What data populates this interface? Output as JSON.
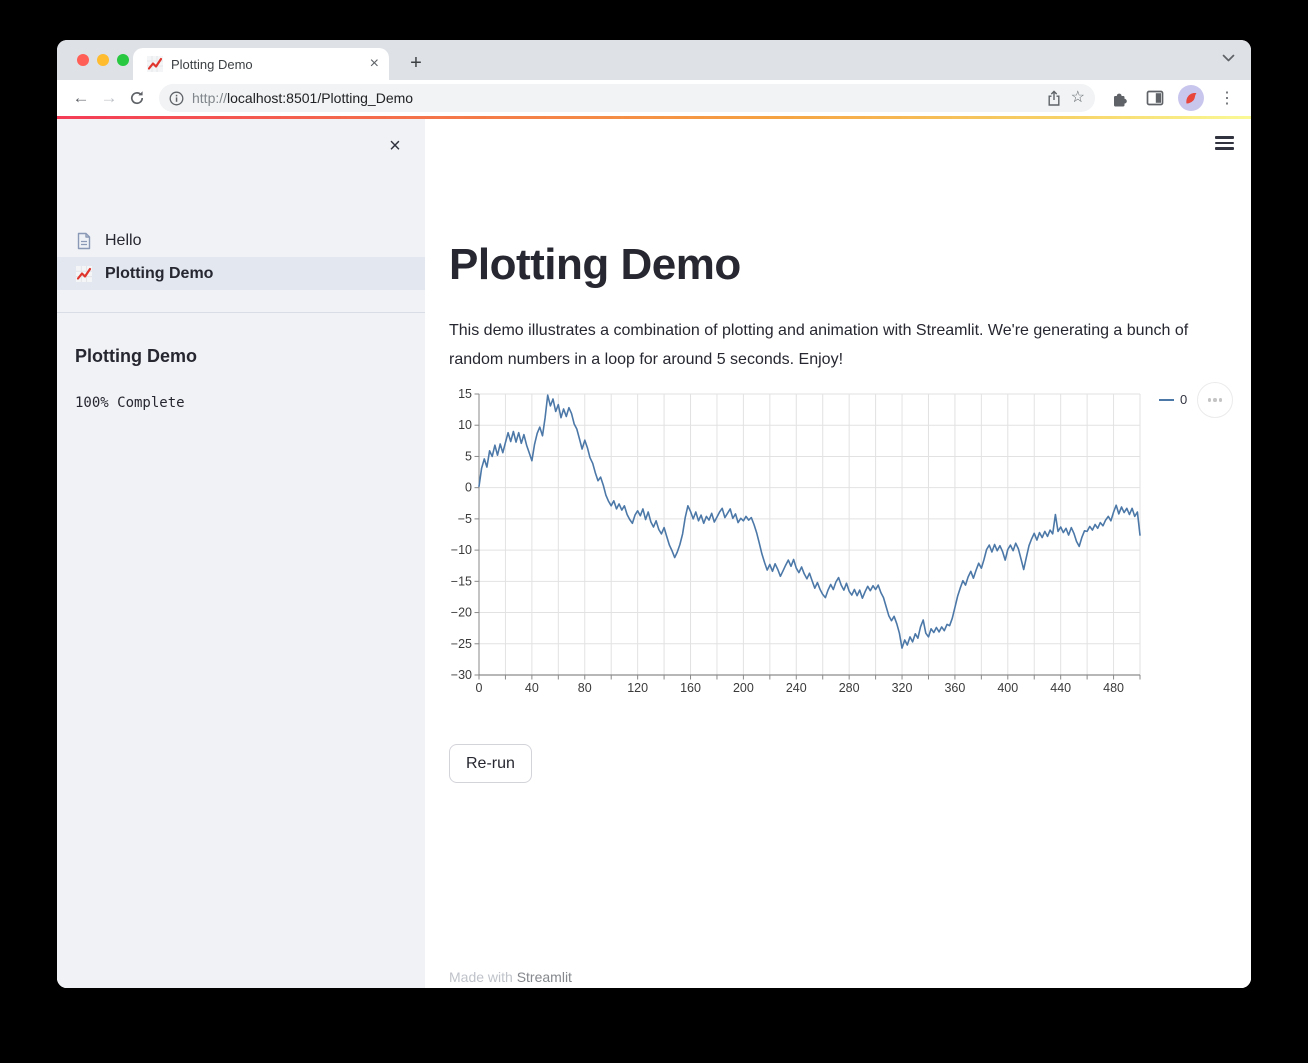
{
  "browser": {
    "tab": {
      "title": "Plotting Demo",
      "favicon": "chart-increasing-icon"
    },
    "new_tab_label": "+",
    "close_tab_label": "×",
    "url": {
      "scheme": "http://",
      "host": "localhost",
      "rest": ":8501/Plotting_Demo"
    },
    "kebab_label": "⋮"
  },
  "sidebar": {
    "close_label": "×",
    "nav": [
      {
        "label": "Hello",
        "icon": "page-icon",
        "selected": false
      },
      {
        "label": "Plotting Demo",
        "icon": "chart-increasing-icon",
        "selected": true
      }
    ],
    "section_title": "Plotting Demo",
    "progress_text": "100% Complete"
  },
  "main": {
    "title": "Plotting Demo",
    "description": "This demo illustrates a combination of plotting and animation with Streamlit. We're generating a bunch of random numbers in a loop for around 5 seconds. Enjoy!",
    "rerun_button": "Re-run",
    "footer_prefix": "Made with ",
    "footer_link": "Streamlit"
  },
  "colors": {
    "decoration_gradient": [
      "#f43b56",
      "#f4724a",
      "#f5a242",
      "#f7d469",
      "#fafa96"
    ],
    "line": "#4c78a8",
    "sidebar_bg": "#f0f2f6",
    "text_dark": "#262730"
  },
  "chart_data": {
    "type": "line",
    "title": "",
    "xlabel": "",
    "ylabel": "",
    "series_name": "0",
    "legend_position": "right",
    "grid": true,
    "xlim": [
      0,
      500
    ],
    "ylim": [
      -30,
      15
    ],
    "x_tick_major": 40,
    "x_tick_minor": 20,
    "y_tick": 5,
    "line_color": "#4c78a8",
    "x_start": 0,
    "x_step": 2,
    "values": [
      0.2,
      3.1,
      4.6,
      3.3,
      5.9,
      5.0,
      6.8,
      5.2,
      7.0,
      5.6,
      7.2,
      8.8,
      7.4,
      9.0,
      7.3,
      8.8,
      7.1,
      8.5,
      6.8,
      5.6,
      4.3,
      6.9,
      8.7,
      9.7,
      8.3,
      11.2,
      14.8,
      13.1,
      14.2,
      12.2,
      13.3,
      11.2,
      12.6,
      11.4,
      12.8,
      11.9,
      10.2,
      9.4,
      7.8,
      6.2,
      7.6,
      6.4,
      4.8,
      3.9,
      2.4,
      1.1,
      1.7,
      0.4,
      -1.2,
      -2.2,
      -2.9,
      -2.1,
      -3.4,
      -2.6,
      -3.6,
      -2.9,
      -4.3,
      -5.1,
      -5.7,
      -4.4,
      -3.7,
      -4.5,
      -3.4,
      -5.1,
      -3.9,
      -5.5,
      -6.3,
      -5.3,
      -6.7,
      -7.4,
      -6.4,
      -7.8,
      -9.2,
      -10.1,
      -11.2,
      -10.3,
      -9.1,
      -7.4,
      -4.8,
      -2.9,
      -3.8,
      -5.0,
      -3.9,
      -5.3,
      -4.4,
      -5.7,
      -4.6,
      -5.2,
      -4.1,
      -5.5,
      -4.7,
      -3.9,
      -3.3,
      -4.8,
      -4.1,
      -3.4,
      -4.9,
      -4.2,
      -5.6,
      -4.9,
      -5.3,
      -4.6,
      -5.2,
      -4.8,
      -5.9,
      -7.2,
      -8.9,
      -10.6,
      -12.0,
      -13.2,
      -12.3,
      -13.4,
      -12.2,
      -13.1,
      -14.2,
      -13.3,
      -12.4,
      -11.6,
      -12.6,
      -11.5,
      -12.9,
      -13.6,
      -12.7,
      -13.8,
      -14.6,
      -13.7,
      -14.9,
      -16.1,
      -15.2,
      -16.3,
      -17.1,
      -17.6,
      -16.4,
      -15.5,
      -16.3,
      -15.1,
      -14.4,
      -15.6,
      -16.4,
      -15.3,
      -16.6,
      -17.2,
      -16.3,
      -17.3,
      -16.4,
      -17.7,
      -16.7,
      -15.8,
      -16.5,
      -15.7,
      -16.3,
      -15.6,
      -16.8,
      -17.6,
      -19.1,
      -20.5,
      -21.3,
      -20.6,
      -21.8,
      -23.3,
      -25.7,
      -24.4,
      -25.2,
      -23.9,
      -24.7,
      -23.4,
      -24.1,
      -22.3,
      -21.2,
      -23.3,
      -23.9,
      -22.6,
      -23.2,
      -22.4,
      -23.1,
      -22.3,
      -22.9,
      -21.9,
      -22.1,
      -20.9,
      -19.2,
      -17.4,
      -16.1,
      -14.9,
      -15.6,
      -14.3,
      -13.4,
      -14.5,
      -13.2,
      -12.1,
      -12.9,
      -11.5,
      -9.9,
      -9.2,
      -10.3,
      -9.1,
      -10.1,
      -9.3,
      -10.2,
      -11.6,
      -9.9,
      -9.2,
      -10.1,
      -8.9,
      -9.8,
      -11.4,
      -13.1,
      -11.2,
      -9.3,
      -8.2,
      -7.3,
      -8.4,
      -7.2,
      -8.0,
      -7.0,
      -7.8,
      -6.8,
      -7.4,
      -4.3,
      -7.0,
      -6.3,
      -7.2,
      -6.5,
      -7.6,
      -6.4,
      -7.3,
      -8.6,
      -9.4,
      -8.0,
      -6.9,
      -7.0,
      -6.2,
      -6.8,
      -5.9,
      -6.5,
      -5.6,
      -6.1,
      -5.2,
      -4.6,
      -5.3,
      -3.9,
      -2.8,
      -4.2,
      -3.1,
      -4.0,
      -3.3,
      -4.3,
      -3.3,
      -4.6,
      -3.9,
      -7.6
    ]
  }
}
